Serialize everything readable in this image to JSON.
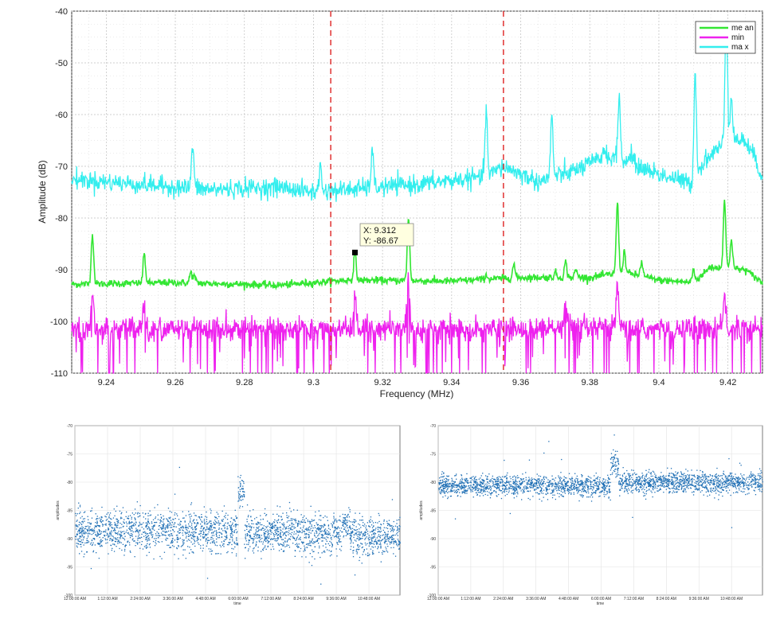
{
  "chart_data": [
    {
      "type": "line",
      "title": "",
      "xlabel": "Frequency (MHz)",
      "ylabel": "Amplitude (dB)",
      "xlim": [
        9.23,
        9.43
      ],
      "ylim": [
        -110,
        -40
      ],
      "x_ticks": [
        "9.24",
        "9.26",
        "9.28",
        "9.3",
        "9.32",
        "9.34",
        "9.36",
        "9.38",
        "9.4",
        "9.42"
      ],
      "y_ticks": [
        "-40",
        "-50",
        "-60",
        "-70",
        "-80",
        "-90",
        "-100",
        "-110"
      ],
      "grid": true,
      "legend": "top-right",
      "series": [
        {
          "name": "me an",
          "color": "#33e633",
          "baseline": [
            [
              9.23,
              -92.8
            ],
            [
              9.26,
              -92.5
            ],
            [
              9.29,
              -93.0
            ],
            [
              9.31,
              -92.0
            ],
            [
              9.34,
              -92.2
            ],
            [
              9.36,
              -91.5
            ],
            [
              9.38,
              -91.5
            ],
            [
              9.39,
              -90.5
            ],
            [
              9.4,
              -92.0
            ],
            [
              9.41,
              -92.5
            ],
            [
              9.415,
              -89.5
            ],
            [
              9.425,
              -90.0
            ],
            [
              9.43,
              -92.5
            ]
          ],
          "peaks": [
            [
              9.236,
              -83
            ],
            [
              9.251,
              -87
            ],
            [
              9.2645,
              -90.5
            ],
            [
              9.2655,
              -91.3
            ],
            [
              9.312,
              -86.67
            ],
            [
              9.3275,
              -80
            ],
            [
              9.35,
              -91
            ],
            [
              9.358,
              -89
            ],
            [
              9.37,
              -90.5
            ],
            [
              9.373,
              -88.5
            ],
            [
              9.376,
              -90
            ],
            [
              9.388,
              -77
            ],
            [
              9.39,
              -86.5
            ],
            [
              9.395,
              -88.5
            ],
            [
              9.41,
              -90
            ],
            [
              9.419,
              -76.5
            ],
            [
              9.421,
              -84
            ]
          ]
        },
        {
          "name": "min",
          "color": "#ee22ee",
          "baseline": [
            [
              9.23,
              -101.5
            ],
            [
              9.43,
              -101.5
            ]
          ],
          "peaks": [
            [
              9.236,
              -95
            ],
            [
              9.251,
              -97
            ],
            [
              9.312,
              -94
            ],
            [
              9.3275,
              -91
            ],
            [
              9.373,
              -96
            ],
            [
              9.388,
              -93
            ],
            [
              9.419,
              -95
            ]
          ]
        },
        {
          "name": "ma x",
          "color": "#33eeee",
          "baseline": [
            [
              9.23,
              -72.5
            ],
            [
              9.25,
              -73.5
            ],
            [
              9.27,
              -74.5
            ],
            [
              9.29,
              -74.0
            ],
            [
              9.3,
              -75.0
            ],
            [
              9.33,
              -73.5
            ],
            [
              9.35,
              -72.0
            ],
            [
              9.355,
              -70.0
            ],
            [
              9.365,
              -73.0
            ],
            [
              9.375,
              -71.0
            ],
            [
              9.385,
              -68.0
            ],
            [
              9.39,
              -69.0
            ],
            [
              9.4,
              -71.5
            ],
            [
              9.41,
              -73.5
            ],
            [
              9.413,
              -69.0
            ],
            [
              9.42,
              -65.0
            ],
            [
              9.425,
              -65.0
            ],
            [
              9.43,
              -72.0
            ]
          ],
          "peaks": [
            [
              9.265,
              -66
            ],
            [
              9.302,
              -70
            ],
            [
              9.317,
              -67
            ],
            [
              9.35,
              -59.5
            ],
            [
              9.369,
              -60.5
            ],
            [
              9.384,
              -66.5
            ],
            [
              9.3885,
              -56.5
            ],
            [
              9.392,
              -67
            ],
            [
              9.4105,
              -51.5
            ],
            [
              9.4195,
              -40
            ],
            [
              9.421,
              -56
            ],
            [
              9.428,
              -68
            ]
          ]
        }
      ],
      "annotations": {
        "vlines_x": [
          9.305,
          9.355
        ],
        "vline_color": "#e03030",
        "datatip": {
          "x": 9.312,
          "y": -86.67,
          "text_x": "X: 9.312",
          "text_y": "Y: -86.67"
        }
      }
    },
    {
      "type": "scatter",
      "title": "",
      "xlabel": "time",
      "ylabel": "amplitudes",
      "ylim": [
        -100,
        -70
      ],
      "x_ticks": [
        "12:00:00 AM",
        "1:12:00 AM",
        "2:24:00 AM",
        "3:36:00 AM",
        "4:48:00 AM",
        "6:00:00 AM",
        "7:12:00 AM",
        "8:24:00 AM",
        "9:36:00 AM",
        "10:48:00 AM"
      ],
      "y_ticks": [
        "-70",
        "-75",
        "-80",
        "-85",
        "-90",
        "-95",
        "-100"
      ],
      "color": "#1f6fb5",
      "segments": [
        [
          0.0,
          0.5,
          -88.5,
          1.8
        ],
        [
          0.5,
          0.52,
          -81.5,
          1.5
        ],
        [
          0.52,
          0.82,
          -89.0,
          1.7
        ],
        [
          0.82,
          0.845,
          -87.5,
          1.0
        ],
        [
          0.845,
          1.0,
          -89.5,
          1.7
        ]
      ]
    },
    {
      "type": "scatter",
      "title": "",
      "xlabel": "time",
      "ylabel": "amplitudes",
      "ylim": [
        -100,
        -70
      ],
      "x_ticks": [
        "12:00:00 AM",
        "1:12:00 AM",
        "2:24:00 AM",
        "3:36:00 AM",
        "4:48:00 AM",
        "6:00:00 AM",
        "7:12:00 AM",
        "8:24:00 AM",
        "9:36:00 AM",
        "10:48:00 AM"
      ],
      "y_ticks": [
        "-70",
        "-75",
        "-80",
        "-85",
        "-90",
        "-95",
        "-100"
      ],
      "color": "#1f6fb5",
      "segments": [
        [
          0.0,
          0.53,
          -80.5,
          0.9
        ],
        [
          0.53,
          0.555,
          -77.0,
          1.4
        ],
        [
          0.555,
          1.0,
          -80.0,
          0.9
        ]
      ]
    }
  ]
}
